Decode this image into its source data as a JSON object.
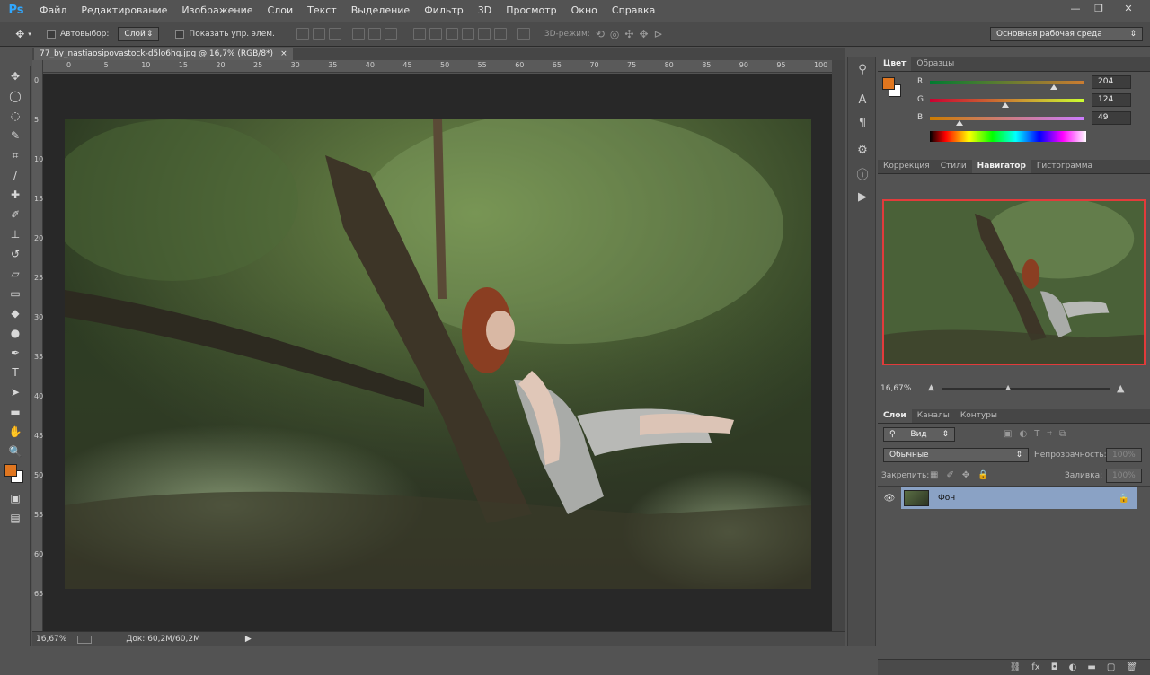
{
  "app": {
    "logo": "Ps"
  },
  "menu": [
    "Файл",
    "Редактирование",
    "Изображение",
    "Слои",
    "Текст",
    "Выделение",
    "Фильтр",
    "3D",
    "Просмотр",
    "Окно",
    "Справка"
  ],
  "window_controls": {
    "minimize": "—",
    "restore": "❐",
    "close": "✕"
  },
  "options": {
    "autoselect_label": "Автовыбор:",
    "autoselect_value": "Слой",
    "show_controls_label": "Показать упр. элем.",
    "mode_3d_label": "3D-режим:",
    "workspace": "Основная рабочая среда"
  },
  "document": {
    "tab_title": "77_by_nastiaosipovastock-d5lo6hg.jpg @ 16,7% (RGB/8*)",
    "tab_close": "×",
    "ruler_h": [
      "0",
      "5",
      "10",
      "15",
      "20",
      "25",
      "30",
      "35",
      "40",
      "45",
      "50",
      "55",
      "60",
      "65",
      "70",
      "75",
      "80",
      "85",
      "90",
      "95",
      "100"
    ],
    "ruler_v": [
      "0",
      "5",
      "10",
      "15",
      "20",
      "25",
      "30",
      "35",
      "40",
      "45",
      "50",
      "55",
      "60",
      "65"
    ]
  },
  "status": {
    "zoom": "16,67%",
    "doc": "Док: 60,2M/60,2M"
  },
  "tools": [
    "move-tool-icon",
    "marquee-icon",
    "lasso-icon",
    "quick-select-icon",
    "crop-icon",
    "eyedropper-icon",
    "healing-icon",
    "brush-icon",
    "clone-stamp-icon",
    "history-brush-icon",
    "eraser-icon",
    "gradient-icon",
    "blur-icon",
    "dodge-icon",
    "pen-icon",
    "type-icon",
    "path-select-icon",
    "shape-icon",
    "hand-icon",
    "zoom-icon"
  ],
  "colors": {
    "foreground": "#e0761f",
    "background": "#ffffff",
    "r": "204",
    "g": "124",
    "b": "49",
    "r_fraction": 0.8,
    "g_fraction": 0.486,
    "b_fraction": 0.192
  },
  "color_panel": {
    "tabs": [
      "Цвет",
      "Образцы"
    ],
    "r_label": "R",
    "g_label": "G",
    "b_label": "B"
  },
  "navigator": {
    "tabs": [
      "Коррекция",
      "Стили",
      "Навигатор",
      "Гистограмма"
    ],
    "zoom": "16,67%"
  },
  "layers": {
    "tabs": [
      "Слои",
      "Каналы",
      "Контуры"
    ],
    "filter_kind": "Вид",
    "blend_mode": "Обычные",
    "opacity_label": "Непрозрачность:",
    "opacity_value": "100%",
    "lock_label": "Закрепить:",
    "fill_label": "Заливка:",
    "fill_value": "100%",
    "items": [
      {
        "name": "Фон",
        "visible": true,
        "locked": true
      }
    ]
  }
}
